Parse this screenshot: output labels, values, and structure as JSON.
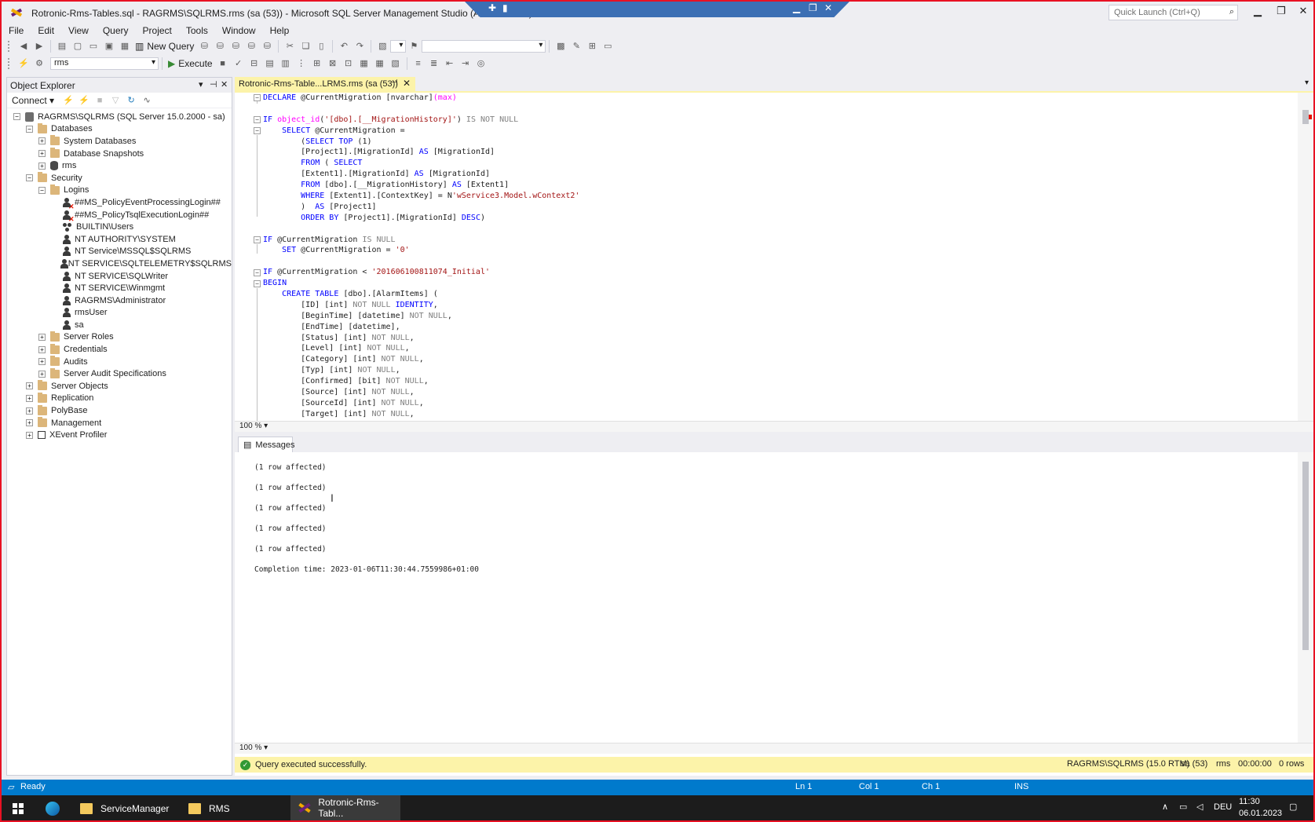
{
  "window": {
    "title": "Rotronic-Rms-Tables.sql - RAGRMS\\SQLRMS.rms (sa (53)) - Microsoft SQL Server Management Studio (Administrator)",
    "quick_launch_placeholder": "Quick Launch (Ctrl+Q)"
  },
  "menu": [
    "File",
    "Edit",
    "View",
    "Query",
    "Project",
    "Tools",
    "Window",
    "Help"
  ],
  "toolbar": {
    "new_query_label": "New Query",
    "database_combo": "rms",
    "execute_label": "Execute"
  },
  "object_explorer": {
    "title": "Object Explorer",
    "connect_label": "Connect",
    "nodes": [
      {
        "label": "RAGRMS\\SQLRMS (SQL Server 15.0.2000 - sa)",
        "icon": "server-icon",
        "expander": "−",
        "level": 0
      },
      {
        "label": "Databases",
        "icon": "folder-icon",
        "expander": "−",
        "level": 1
      },
      {
        "label": "System Databases",
        "icon": "folder-icon",
        "expander": "+",
        "level": 2
      },
      {
        "label": "Database Snapshots",
        "icon": "folder-icon",
        "expander": "+",
        "level": 2
      },
      {
        "label": "rms",
        "icon": "database-icon",
        "expander": "+",
        "level": 2
      },
      {
        "label": "Security",
        "icon": "folder-icon",
        "expander": "−",
        "level": 1
      },
      {
        "label": "Logins",
        "icon": "folder-icon",
        "expander": "−",
        "level": 2
      },
      {
        "label": "##MS_PolicyEventProcessingLogin##",
        "icon": "disabled-login-icon",
        "expander": "",
        "level": 3
      },
      {
        "label": "##MS_PolicyTsqlExecutionLogin##",
        "icon": "disabled-login-icon",
        "expander": "",
        "level": 3
      },
      {
        "label": "BUILTIN\\Users",
        "icon": "group-login-icon",
        "expander": "",
        "level": 3
      },
      {
        "label": "NT AUTHORITY\\SYSTEM",
        "icon": "login-icon",
        "expander": "",
        "level": 3
      },
      {
        "label": "NT Service\\MSSQL$SQLRMS",
        "icon": "login-icon",
        "expander": "",
        "level": 3
      },
      {
        "label": "NT SERVICE\\SQLTELEMETRY$SQLRMS",
        "icon": "login-icon",
        "expander": "",
        "level": 3
      },
      {
        "label": "NT SERVICE\\SQLWriter",
        "icon": "login-icon",
        "expander": "",
        "level": 3
      },
      {
        "label": "NT SERVICE\\Winmgmt",
        "icon": "login-icon",
        "expander": "",
        "level": 3
      },
      {
        "label": "RAGRMS\\Administrator",
        "icon": "login-icon",
        "expander": "",
        "level": 3
      },
      {
        "label": "rmsUser",
        "icon": "login-icon",
        "expander": "",
        "level": 3
      },
      {
        "label": "sa",
        "icon": "login-icon",
        "expander": "",
        "level": 3
      },
      {
        "label": "Server Roles",
        "icon": "folder-icon",
        "expander": "+",
        "level": 2
      },
      {
        "label": "Credentials",
        "icon": "folder-icon",
        "expander": "+",
        "level": 2
      },
      {
        "label": "Audits",
        "icon": "folder-icon",
        "expander": "+",
        "level": 2
      },
      {
        "label": "Server Audit Specifications",
        "icon": "folder-icon",
        "expander": "+",
        "level": 2
      },
      {
        "label": "Server Objects",
        "icon": "folder-icon",
        "expander": "+",
        "level": 1
      },
      {
        "label": "Replication",
        "icon": "folder-icon",
        "expander": "+",
        "level": 1
      },
      {
        "label": "PolyBase",
        "icon": "folder-icon",
        "expander": "+",
        "level": 1
      },
      {
        "label": "Management",
        "icon": "folder-icon",
        "expander": "+",
        "level": 1
      },
      {
        "label": "XEvent Profiler",
        "icon": "xevent-icon",
        "expander": "+",
        "level": 1
      }
    ]
  },
  "document": {
    "tab_label": "Rotronic-Rms-Table...LRMS.rms (sa (53))",
    "zoom": "100 %",
    "code_lines": [
      "DECLARE @CurrentMigration [nvarchar](max)",
      "",
      "IF object_id('[dbo].[__MigrationHistory]') IS NOT NULL",
      "    SELECT @CurrentMigration =",
      "        (SELECT TOP (1)",
      "        [Project1].[MigrationId] AS [MigrationId]",
      "        FROM ( SELECT",
      "        [Extent1].[MigrationId] AS [MigrationId]",
      "        FROM [dbo].[__MigrationHistory] AS [Extent1]",
      "        WHERE [Extent1].[ContextKey] = N'wService3.Model.wContext2'",
      "        )  AS [Project1]",
      "        ORDER BY [Project1].[MigrationId] DESC)",
      "",
      "IF @CurrentMigration IS NULL",
      "    SET @CurrentMigration = '0'",
      "",
      "IF @CurrentMigration < '201606100811074_Initial'",
      "BEGIN",
      "    CREATE TABLE [dbo].[AlarmItems] (",
      "        [ID] [int] NOT NULL IDENTITY,",
      "        [BeginTime] [datetime] NOT NULL,",
      "        [EndTime] [datetime],",
      "        [Status] [int] NOT NULL,",
      "        [Level] [int] NOT NULL,",
      "        [Category] [int] NOT NULL,",
      "        [Typ] [int] NOT NULL,",
      "        [Confirmed] [bit] NOT NULL,",
      "        [Source] [int] NOT NULL,",
      "        [SourceId] [int] NOT NULL,",
      "        [Target] [int] NOT NULL,"
    ]
  },
  "results": {
    "tab_label": "Messages",
    "zoom": "100 %",
    "messages": [
      "(1 row affected)",
      "(1 row affected)",
      "(1 row affected)",
      "(1 row affected)",
      "(1 row affected)",
      "Completion time: 2023-01-06T11:30:44.7559986+01:00"
    ]
  },
  "query_status": {
    "message": "Query executed successfully.",
    "server": "RAGRMS\\SQLRMS (15.0 RTM)",
    "user": "sa (53)",
    "database": "rms",
    "elapsed": "00:00:00",
    "rows": "0 rows"
  },
  "statusbar": {
    "state": "Ready",
    "line": "Ln 1",
    "col": "Col 1",
    "ch": "Ch 1",
    "mode": "INS"
  },
  "taskbar": {
    "apps": [
      "ServiceManager",
      "RMS",
      "Rotronic-Rms-Tabl..."
    ],
    "language": "DEU",
    "time": "11:30",
    "date": "06.01.2023"
  },
  "colors": {
    "accent": "#007acc",
    "query_tab": "#fcf3a9",
    "window_border": "#e81123"
  }
}
